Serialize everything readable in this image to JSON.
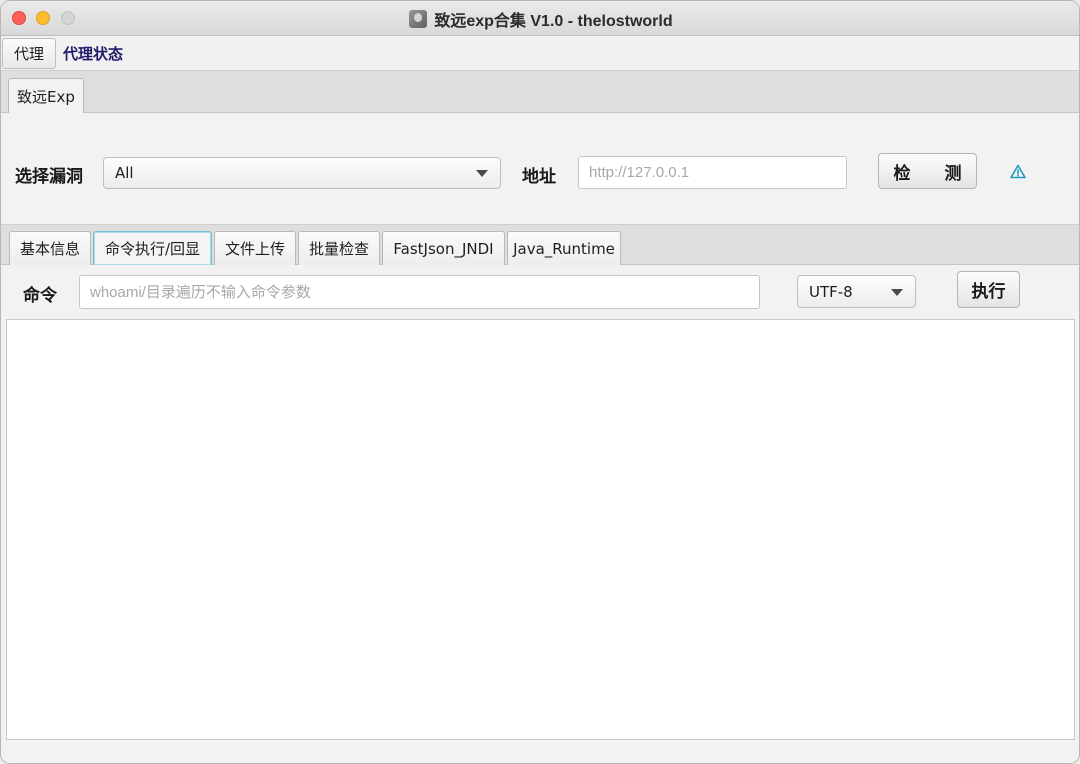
{
  "window": {
    "title": "致远exp合集 V1.0 - thelostworld"
  },
  "menubar": {
    "proxy": "代理",
    "proxy_status": "代理状态"
  },
  "top_tab": {
    "label": "致远Exp"
  },
  "probe": {
    "vuln_label": "选择漏洞",
    "vuln_selected": "All",
    "address_label": "地址",
    "address_placeholder": "http://127.0.0.1",
    "detect_button": "检　　测",
    "warning_icon": "warning-triangle-icon"
  },
  "inner_tabs": [
    {
      "label": "基本信息"
    },
    {
      "label": "命令执行/回显",
      "active": true
    },
    {
      "label": "文件上传"
    },
    {
      "label": "批量检查"
    },
    {
      "label": "FastJson_JNDI"
    },
    {
      "label": "Java_Runtime"
    }
  ],
  "command": {
    "label": "命令",
    "placeholder": "whoami/目录遍历不输入命令参数",
    "encoding": "UTF-8",
    "execute_button": "执行"
  },
  "output": {
    "text": ""
  },
  "colors": {
    "active_tab_border": "#6cc0d8",
    "menu_status_text": "#211a6b",
    "warning_icon": "#1e9bc4"
  }
}
